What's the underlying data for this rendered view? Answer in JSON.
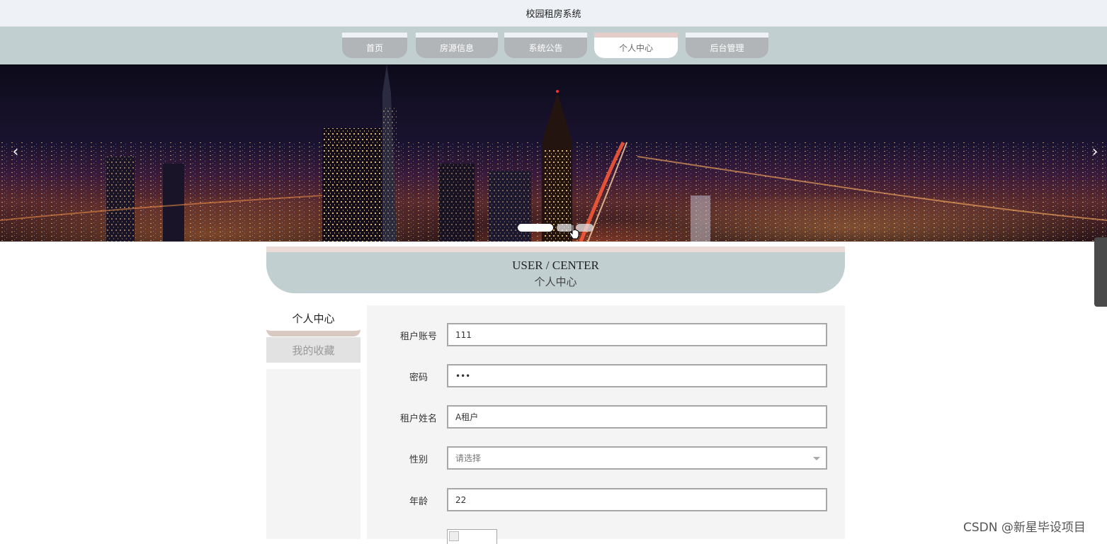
{
  "site": {
    "title": "校园租房系统"
  },
  "nav": {
    "items": [
      {
        "label": "首页",
        "active": false
      },
      {
        "label": "房源信息",
        "active": false
      },
      {
        "label": "系统公告",
        "active": false
      },
      {
        "label": "个人中心",
        "active": true
      },
      {
        "label": "后台管理",
        "active": false
      }
    ]
  },
  "banner": {
    "prev_icon": "chevron-left-icon",
    "next_icon": "chevron-right-icon",
    "prev_glyph": "‹",
    "next_glyph": "›",
    "slide_count": 3,
    "active_slide": 1
  },
  "section": {
    "title_en": "USER / CENTER",
    "title_cn": "个人中心"
  },
  "side_menu": {
    "items": [
      {
        "label": "个人中心",
        "active": true
      },
      {
        "label": "我的收藏",
        "active": false
      }
    ]
  },
  "form": {
    "fields": [
      {
        "label": "租户账号",
        "value": "111",
        "type": "text"
      },
      {
        "label": "密码",
        "value": "•••",
        "type": "password"
      },
      {
        "label": "租户姓名",
        "value": "A租户",
        "type": "text"
      },
      {
        "label": "性别",
        "value": "请选择",
        "type": "select"
      },
      {
        "label": "年龄",
        "value": "22",
        "type": "text"
      }
    ]
  },
  "watermark": "CSDN @新星毕设项目",
  "colors": {
    "nav_bg": "#c1cfd1",
    "nav_item_bg": "#b2b5b7",
    "accent_pink": "#e4cdc8",
    "panel_bg": "#f4f4f4"
  }
}
